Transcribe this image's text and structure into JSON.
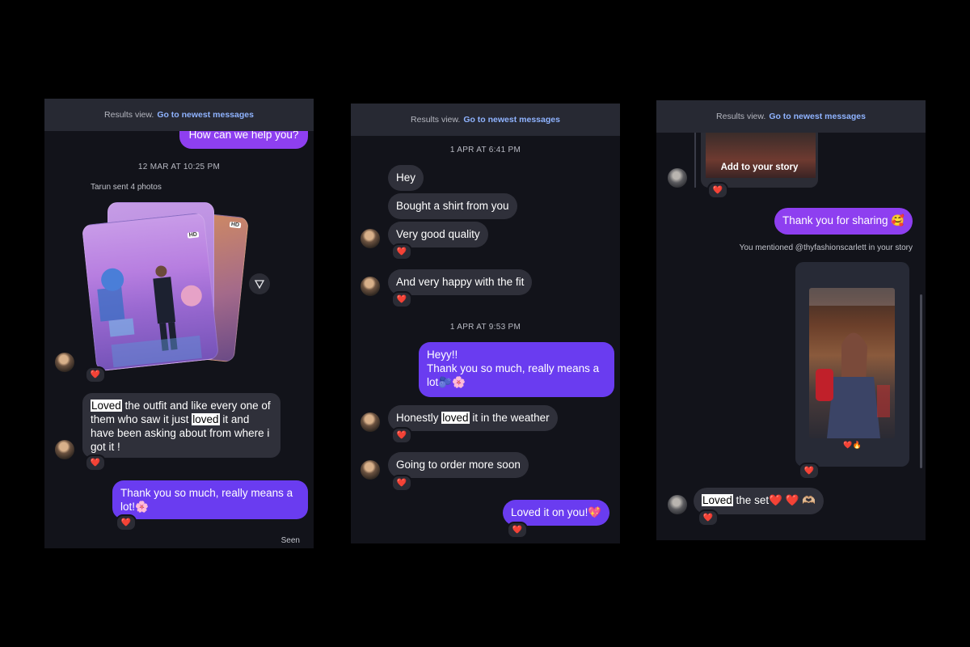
{
  "panel1": {
    "banner": {
      "text": "Results view.",
      "link": "Go to newest messages"
    },
    "top_out": "How can we help you?",
    "timestamp": "12 MAR AT 10:25 PM",
    "sent_photos": "Tarun sent 4 photos",
    "hd_badge": "HD",
    "msg_loved_parts": [
      "Loved",
      " the outfit and like every one of them who saw it just ",
      "loved",
      " it and have been asking about from where i got it !"
    ],
    "reply": "Thank you so much, really means a lot!🌸",
    "seen": "Seen",
    "reaction": "❤️"
  },
  "panel2": {
    "banner": {
      "text": "Results view.",
      "link": "Go to newest messages"
    },
    "ts1": "1 APR AT 6:41 PM",
    "m1": "Hey",
    "m2": "Bought a shirt from you",
    "m3": "Very good quality",
    "m4": "And very happy with the fit",
    "ts2": "1 APR AT 9:53 PM",
    "out1": "Heyy!!\nThank you so much, really means a lot🫐🌸",
    "m5_parts": [
      "Honestly ",
      "loved",
      " it in the weather"
    ],
    "m6": "Going to order more soon",
    "out2": "Loved it on you!💖",
    "reaction": "❤️"
  },
  "panel3": {
    "banner": {
      "text": "Results view.",
      "link": "Go to newest messages"
    },
    "add_story": "Add to your story",
    "out1": "Thank you for sharing 🥰",
    "mention": "You mentioned @thyfashionscarlett in your story",
    "story_caption": "❤️🔥",
    "last_parts": [
      "Loved",
      " the set❤️ ❤️ 🫶🏼"
    ],
    "reaction": "❤️"
  },
  "colors": {
    "background": "#000000",
    "panel": "#12131a",
    "incoming": "#2f303a",
    "outgoing": "#6a3cf0",
    "outgoing_alt": "#8e3ff0",
    "link": "#8fb3ff"
  },
  "icons": [
    "send-icon",
    "heart-reaction-icon",
    "avatar"
  ]
}
